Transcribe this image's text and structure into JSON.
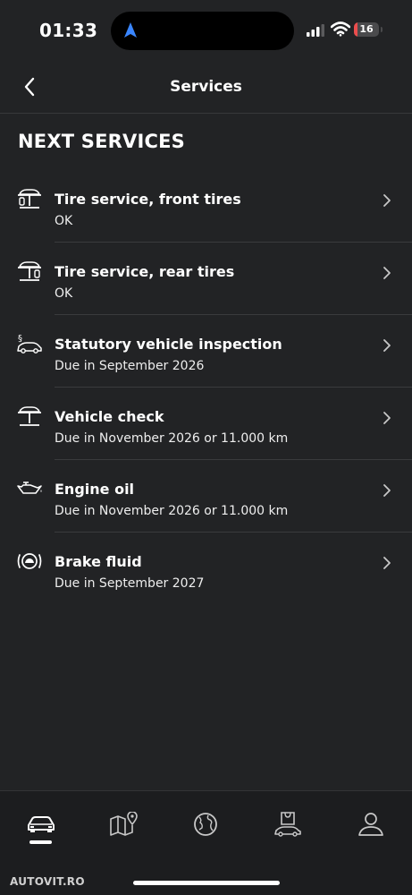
{
  "status_bar": {
    "time": "01:33",
    "location_icon": "navigation-arrow-icon",
    "signal_icon": "cellular-signal-icon",
    "wifi_icon": "wifi-icon",
    "battery_level": "16",
    "battery_fraction": 0.16,
    "battery_color": "#eb4d4d"
  },
  "header": {
    "back_icon": "chevron-left-icon",
    "title": "Services"
  },
  "section_title": "NEXT SERVICES",
  "services": [
    {
      "icon": "tire-lift-icon",
      "title": "Tire service, front tires",
      "status": "OK"
    },
    {
      "icon": "tire-lift-icon",
      "title": "Tire service, rear tires",
      "status": "OK"
    },
    {
      "icon": "vehicle-inspection-icon",
      "title": "Statutory vehicle inspection",
      "status": "Due in September 2026"
    },
    {
      "icon": "vehicle-lift-icon",
      "title": "Vehicle check",
      "status": "Due in November 2026 or 11.000 km"
    },
    {
      "icon": "oil-can-icon",
      "title": "Engine oil",
      "status": "Due in November 2026 or 11.000 km"
    },
    {
      "icon": "brake-fluid-icon",
      "title": "Brake fluid",
      "status": "Due in September 2027"
    }
  ],
  "tab_bar": {
    "tabs": [
      {
        "icon": "car-icon",
        "active": true
      },
      {
        "icon": "map-icon",
        "active": false
      },
      {
        "icon": "globe-icon",
        "active": false
      },
      {
        "icon": "shop-icon",
        "active": false
      },
      {
        "icon": "profile-icon",
        "active": false
      }
    ]
  },
  "watermark": "AUTOVIT.RO",
  "colors": {
    "background": "#222325",
    "tab_bar_background": "#1c1d1f",
    "accent_location": "#3a86ff"
  }
}
